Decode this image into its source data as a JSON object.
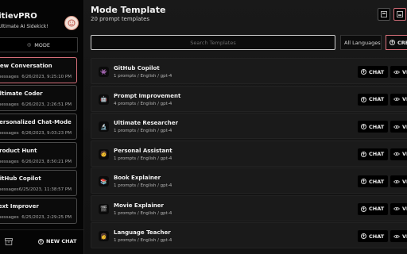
{
  "sidebar": {
    "brand": "unitievPRO",
    "tagline": "Ultimate AI Sidekick!",
    "mode_label": "MODE",
    "conversations": [
      {
        "title": "New Conversation",
        "messages": "messages",
        "date": "6/26/2023, 9:25:10 PM",
        "active": true
      },
      {
        "title": "Ultimate Coder",
        "messages": "messages",
        "date": "6/26/2023, 2:26:51 PM",
        "active": false
      },
      {
        "title": "Personalized Chat-Mode",
        "messages": "messages",
        "date": "6/26/2023, 9:03:23 PM",
        "active": false
      },
      {
        "title": "Product Hunt",
        "messages": "messages",
        "date": "6/26/2023, 8:50:21 PM",
        "active": false
      },
      {
        "title": "GitHub Copilot",
        "messages": "messages",
        "date": "6/25/2023, 11:38:57 PM",
        "active": false
      },
      {
        "title": "Text Improver",
        "messages": "messages",
        "date": "6/25/2023, 2:29:25 PM",
        "active": false
      }
    ],
    "new_chat_label": "NEW CHAT"
  },
  "header": {
    "title": "Mode Template",
    "subtitle": "20 prompt templates"
  },
  "toolbar": {
    "search_placeholder": "Search Templates",
    "language_label": "All Languages",
    "create_label": "CREATE"
  },
  "templates": [
    {
      "name": "GitHub Copilot",
      "meta": "1 prompts / English / gpt-4",
      "icon": "github-copilot-icon",
      "glyph": "👾"
    },
    {
      "name": "Prompt Improvement",
      "meta": "4 prompts / English / gpt-4",
      "icon": "robot-icon",
      "glyph": "🤖"
    },
    {
      "name": "Ultimate Researcher",
      "meta": "1 prompts / English / gpt-4",
      "icon": "researcher-icon",
      "glyph": "🔬"
    },
    {
      "name": "Personal Assistant",
      "meta": "1 prompts / English / gpt-4",
      "icon": "assistant-icon",
      "glyph": "🧑"
    },
    {
      "name": "Book Explainer",
      "meta": "1 prompts / English / gpt-4",
      "icon": "book-icon",
      "glyph": "📚"
    },
    {
      "name": "Movie Explainer",
      "meta": "1 prompts / English / gpt-4",
      "icon": "movie-icon",
      "glyph": "🎬"
    },
    {
      "name": "Language Teacher",
      "meta": "1 prompts / English / gpt-4",
      "icon": "teacher-icon",
      "glyph": "👩"
    }
  ],
  "actions": {
    "chat_label": "CHAT",
    "view_label": "VIEW"
  },
  "colors": {
    "accent": "#d7707b",
    "background": "#111112",
    "row": "#1a1a1a"
  }
}
